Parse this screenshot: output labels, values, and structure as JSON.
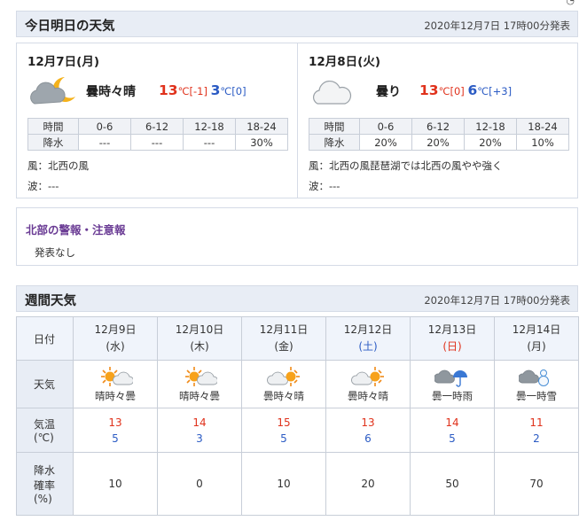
{
  "today_tomorrow": {
    "title": "今日明日の天気",
    "published": "2020年12月7日 17時00分発表",
    "days": [
      {
        "date": "12月7日(月)",
        "icon": "cloudy-night-moon-icon",
        "weather": "曇時々晴",
        "high": "13",
        "high_unit": "℃[-1]",
        "low": "3",
        "low_unit": "℃[0]",
        "rain_headers": [
          "時間",
          "0-6",
          "6-12",
          "12-18",
          "18-24"
        ],
        "rain_values": [
          "降水",
          "---",
          "---",
          "---",
          "30%"
        ],
        "wind": "風：北西の風",
        "wave": "波：---"
      },
      {
        "date": "12月8日(火)",
        "icon": "cloud-icon",
        "weather": "曇り",
        "high": "13",
        "high_unit": "℃[0]",
        "low": "6",
        "low_unit": "℃[+3]",
        "rain_headers": [
          "時間",
          "0-6",
          "6-12",
          "12-18",
          "18-24"
        ],
        "rain_values": [
          "降水",
          "20%",
          "20%",
          "20%",
          "10%"
        ],
        "wind": "風：北西の風琵琶湖では北西の風やや強く",
        "wave": "波：---"
      }
    ]
  },
  "warnings": {
    "title": "北部の警報・注意報",
    "text": "発表なし"
  },
  "weekly": {
    "title": "週間天気",
    "published": "2020年12月7日 17時00分発表",
    "row_labels": {
      "date": "日付",
      "weather": "天気",
      "temp_1": "気温",
      "temp_2": "(℃)",
      "prob_1": "降水",
      "prob_2": "確率",
      "prob_3": "(%)"
    },
    "days": [
      {
        "date": "12月9日",
        "dow": "(水)",
        "dow_type": "weekday",
        "icon": "sun-cloud-icon",
        "weather": "晴時々曇",
        "high": "13",
        "low": "5",
        "prob": "10"
      },
      {
        "date": "12月10日",
        "dow": "(木)",
        "dow_type": "weekday",
        "icon": "sun-cloud-icon",
        "weather": "晴時々曇",
        "high": "14",
        "low": "3",
        "prob": "0"
      },
      {
        "date": "12月11日",
        "dow": "(金)",
        "dow_type": "weekday",
        "icon": "cloud-sun-icon",
        "weather": "曇時々晴",
        "high": "15",
        "low": "5",
        "prob": "10"
      },
      {
        "date": "12月12日",
        "dow": "(土)",
        "dow_type": "saturday",
        "icon": "cloud-sun-icon",
        "weather": "曇時々晴",
        "high": "13",
        "low": "6",
        "prob": "20"
      },
      {
        "date": "12月13日",
        "dow": "(日)",
        "dow_type": "sunday",
        "icon": "cloud-umbrella-icon",
        "weather": "曇一時雨",
        "high": "14",
        "low": "5",
        "prob": "50"
      },
      {
        "date": "12月14日",
        "dow": "(月)",
        "dow_type": "weekday",
        "icon": "cloud-snowman-icon",
        "weather": "曇一時雪",
        "high": "11",
        "low": "2",
        "prob": "70"
      }
    ]
  }
}
